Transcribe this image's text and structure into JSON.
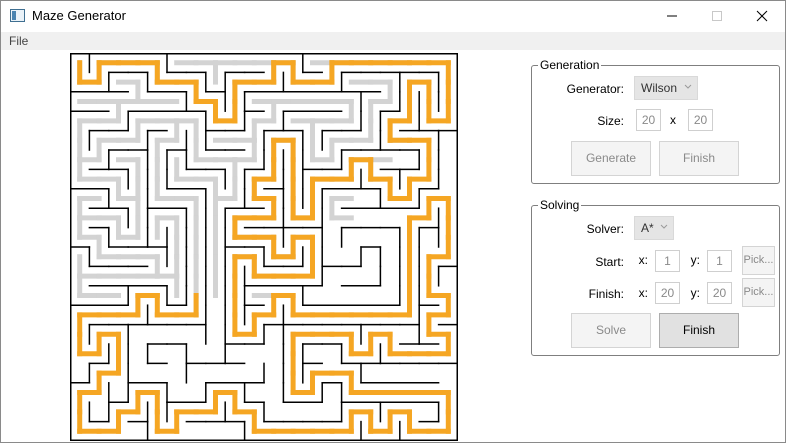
{
  "window": {
    "title": "Maze Generator"
  },
  "menu": {
    "file": "File"
  },
  "generation": {
    "legend": "Generation",
    "generator_label": "Generator:",
    "generator_value": "Wilson",
    "size_label": "Size:",
    "size_w": "20",
    "size_x": "x",
    "size_h": "20",
    "generate_button": "Generate",
    "finish_button": "Finish"
  },
  "solving": {
    "legend": "Solving",
    "solver_label": "Solver:",
    "solver_value": "A*",
    "start_label": "Start:",
    "start_x_label": "x:",
    "start_x": "1",
    "start_y_label": "y:",
    "start_y": "1",
    "start_pick": "Pick...",
    "finish_label": "Finish:",
    "finish_x_label": "x:",
    "finish_x": "20",
    "finish_y_label": "y:",
    "finish_y": "20",
    "finish_pick": "Pick...",
    "solve_button": "Solve",
    "finish_button": "Finish"
  },
  "maze": {
    "grid_size": 20,
    "wall_color": "#000000",
    "explored_color": "#d3d3d3",
    "path_color": "#f5a623"
  }
}
